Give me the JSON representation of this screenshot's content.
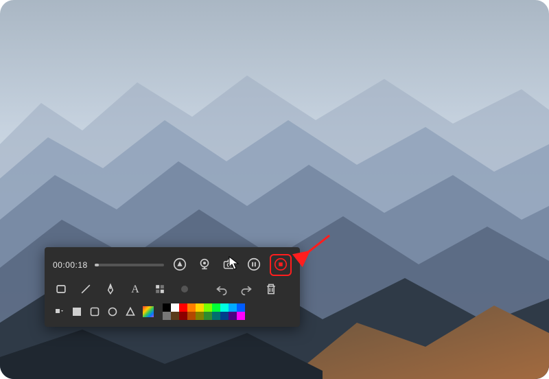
{
  "recorder": {
    "timer": "00:00:18",
    "controls": {
      "markup": "markup",
      "webcam": "webcam",
      "screenshot": "screenshot",
      "pause": "pause",
      "stop": "stop"
    },
    "tools": {
      "rectangle": "rectangle",
      "line": "line",
      "pen": "pen",
      "text": "text",
      "mosaic": "mosaic",
      "brush": "brush",
      "undo": "undo",
      "redo": "redo",
      "delete": "delete"
    },
    "shapes": {
      "fill_square": "filled-square",
      "outline_square": "outline-square",
      "rounded": "rounded-square",
      "circle": "circle",
      "triangle": "triangle",
      "color_picker": "color-picker"
    }
  },
  "palette": [
    "#000000",
    "#ffffff",
    "#ff0000",
    "#ff7f00",
    "#ffd400",
    "#7cff00",
    "#00ff37",
    "#00ffe1",
    "#00aaff",
    "#005cff",
    "#777777",
    "#5a3b1a",
    "#8b0000",
    "#b34700",
    "#808000",
    "#2e8b2e",
    "#006e6e",
    "#003e8b",
    "#4b0082",
    "#ff00ff"
  ],
  "highlight": "stop",
  "colors": {
    "highlight": "#ff1e1e",
    "panel_bg": "#2e2e2e"
  }
}
